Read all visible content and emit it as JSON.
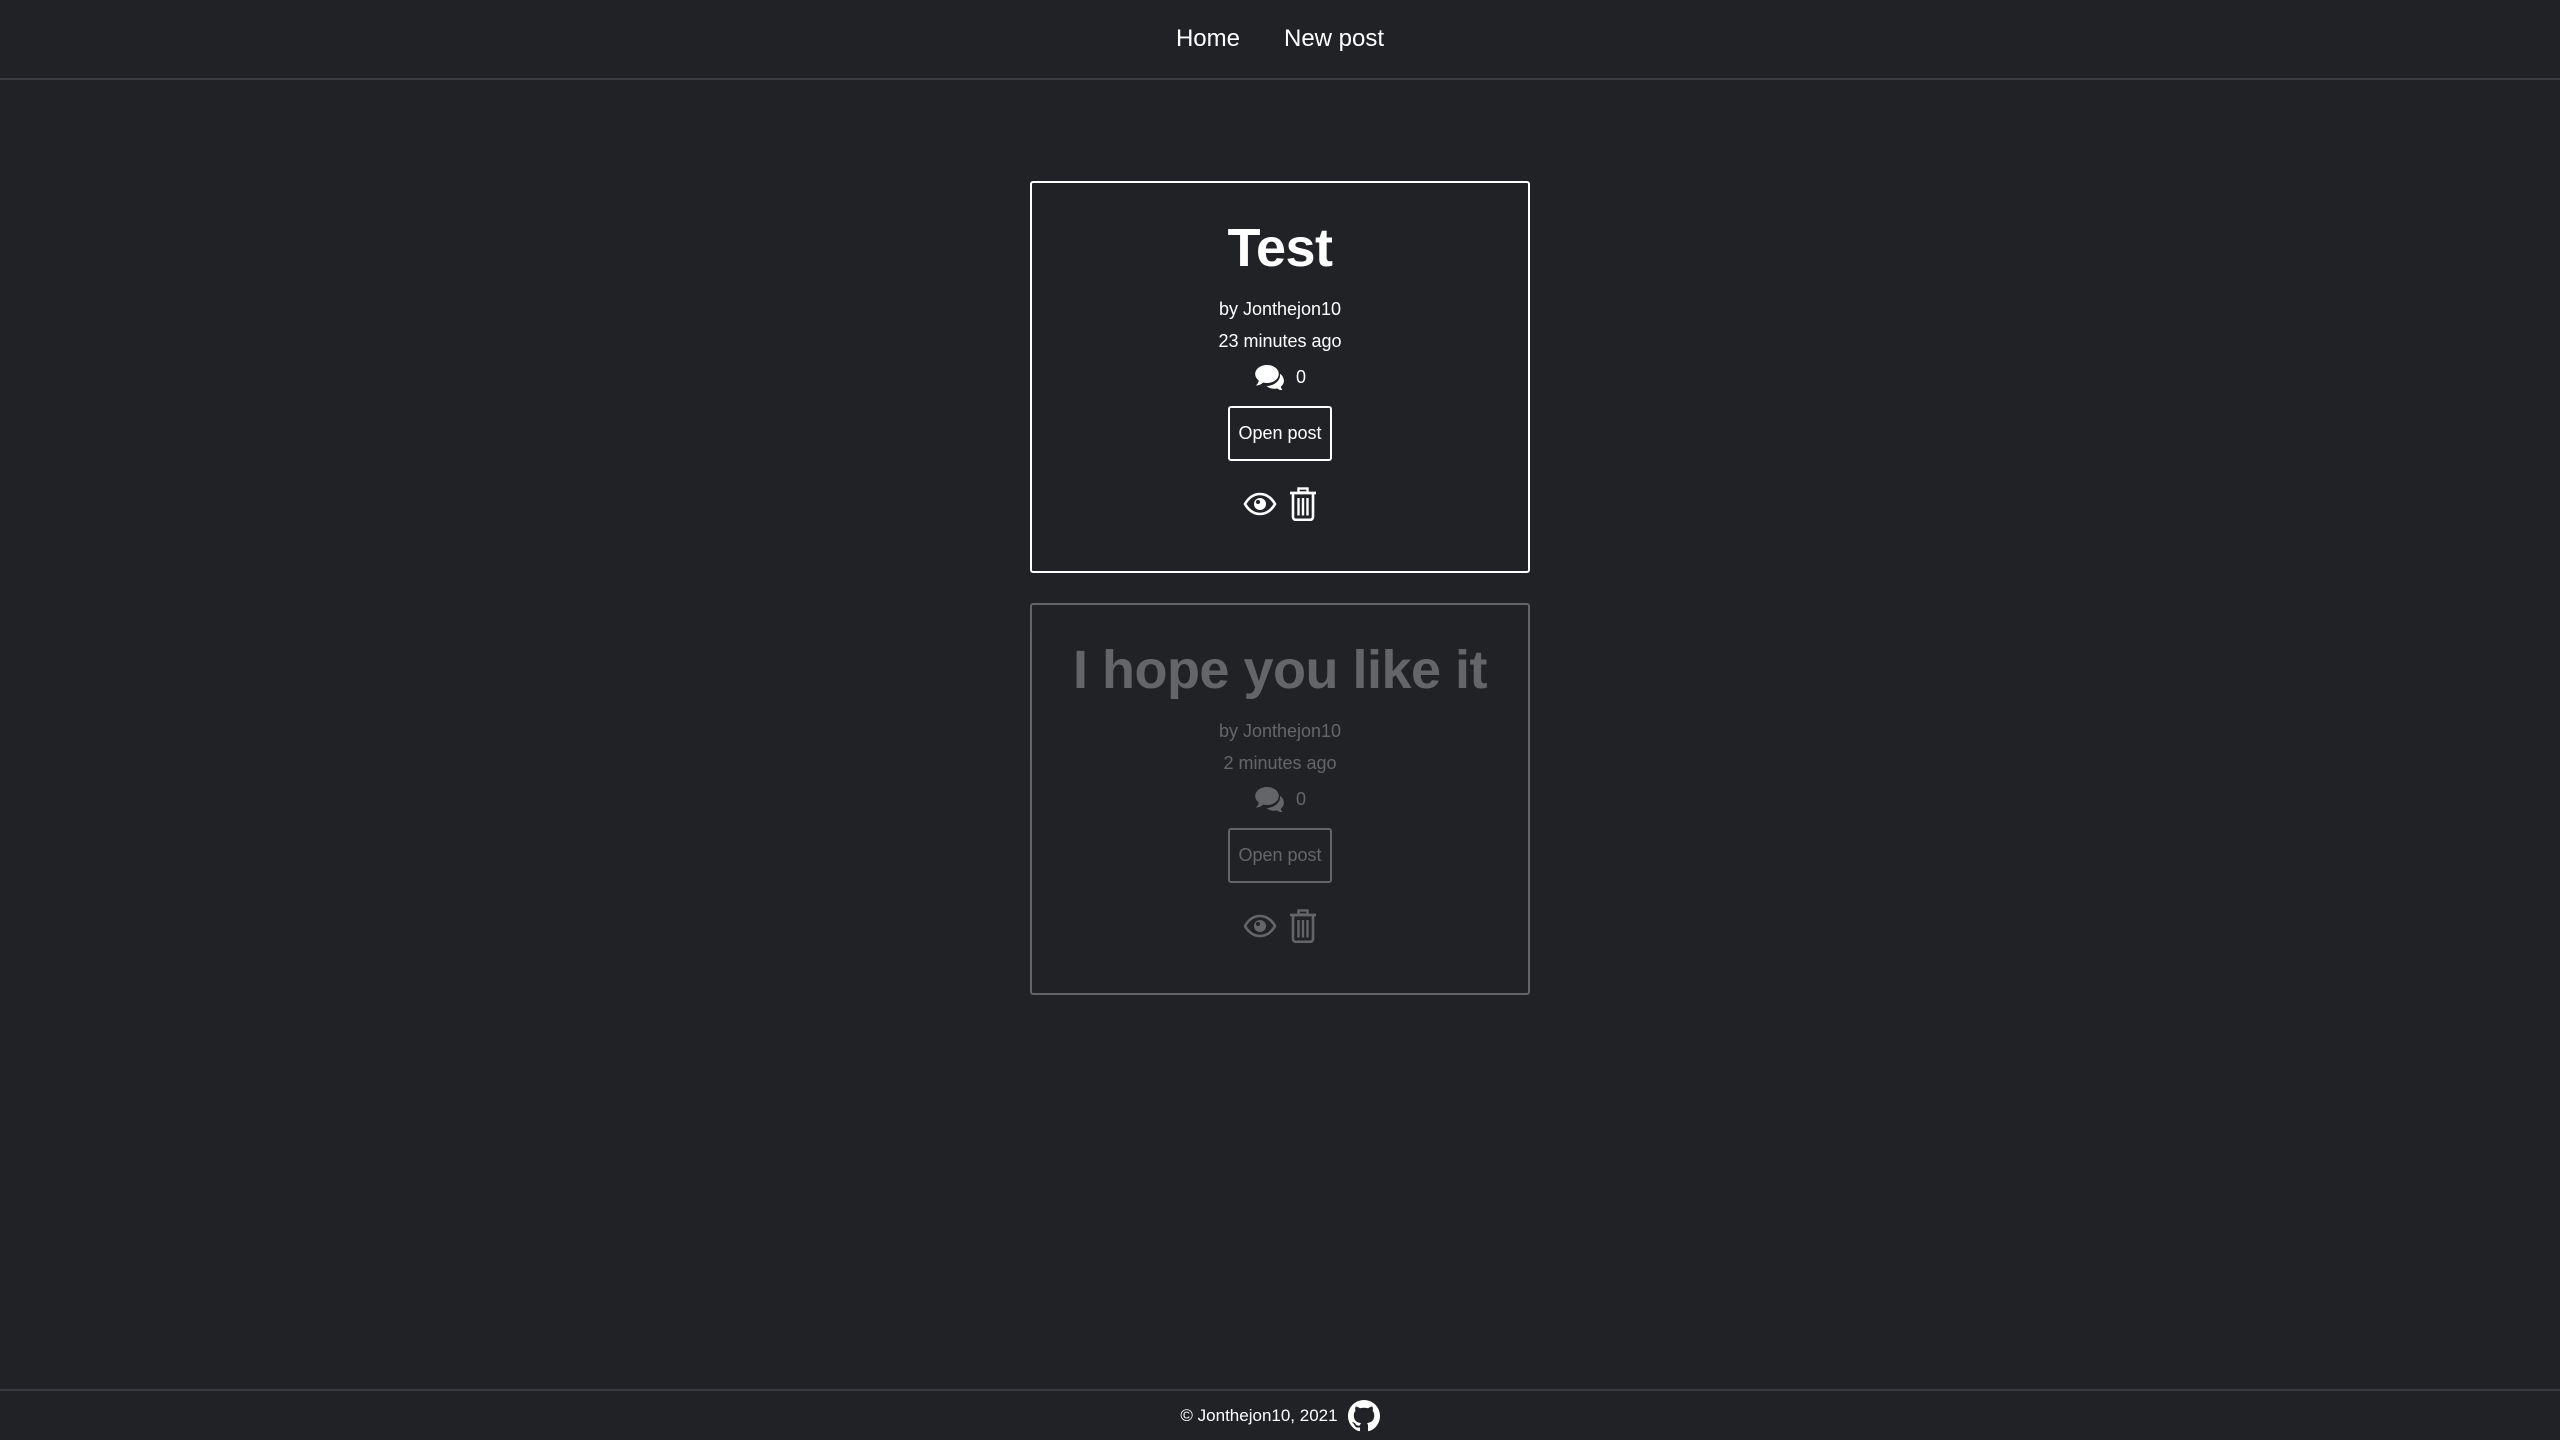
{
  "nav": {
    "items": [
      {
        "label": "Home"
      },
      {
        "label": "New post"
      }
    ]
  },
  "posts": [
    {
      "title": "Test",
      "author": "by Jonthejon10",
      "time": "23 minutes ago",
      "comment_count": "0",
      "open_label": "Open post",
      "faded": false
    },
    {
      "title": "I hope you like it",
      "author": "by Jonthejon10",
      "time": "2 minutes ago",
      "comment_count": "0",
      "open_label": "Open post",
      "faded": true
    }
  ],
  "footer": {
    "copyright": "© Jonthejon10, 2021",
    "icon": "github-icon"
  },
  "icons": {
    "comments": "comments-icon",
    "view": "eye-icon",
    "delete": "trash-icon"
  },
  "colors": {
    "background": "#212226",
    "border": "#3a3b40",
    "text": "#ffffff"
  }
}
